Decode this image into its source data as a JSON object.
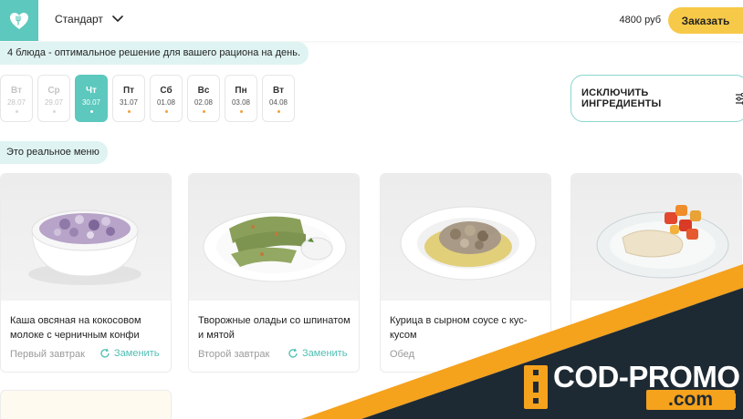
{
  "header": {
    "plan_label": "Стандарт",
    "price": "4800 руб",
    "order_label": "Заказать"
  },
  "info_text": "4 блюда - оптимальное решение для вашего рациона на день.",
  "days": [
    {
      "name": "Вт",
      "date": "28.07",
      "state": "past"
    },
    {
      "name": "Ср",
      "date": "29.07",
      "state": "past"
    },
    {
      "name": "Чт",
      "date": "30.07",
      "state": "active"
    },
    {
      "name": "Пт",
      "date": "31.07",
      "state": "normal"
    },
    {
      "name": "Сб",
      "date": "01.08",
      "state": "normal"
    },
    {
      "name": "Вс",
      "date": "02.08",
      "state": "normal"
    },
    {
      "name": "Пн",
      "date": "03.08",
      "state": "normal"
    },
    {
      "name": "Вт",
      "date": "04.08",
      "state": "normal"
    }
  ],
  "exclude_label": "ИСКЛЮЧИТЬ ИНГРЕДИЕНТЫ",
  "real_menu_label": "Это реальное меню",
  "cards": [
    {
      "name": "Каша овсяная на кокосовом молоке с черничным конфи",
      "meal": "Первый завтрак",
      "replace": "Заменить"
    },
    {
      "name": "Творожные оладьи со шпинатом и мятой",
      "meal": "Второй завтрак",
      "replace": "Заменить"
    },
    {
      "name": "Курица в сырном соусе с кус-кусом",
      "meal": "Обед",
      "replace": ""
    },
    {
      "name": "",
      "meal": "",
      "replace": ""
    }
  ],
  "promo": {
    "main": "COD-PROMO",
    "sub": ".com"
  },
  "colors": {
    "accent": "#5cc8be",
    "order_button": "#f7c948",
    "promo_dark": "#1e2a33",
    "promo_orange": "#f5a21d"
  }
}
